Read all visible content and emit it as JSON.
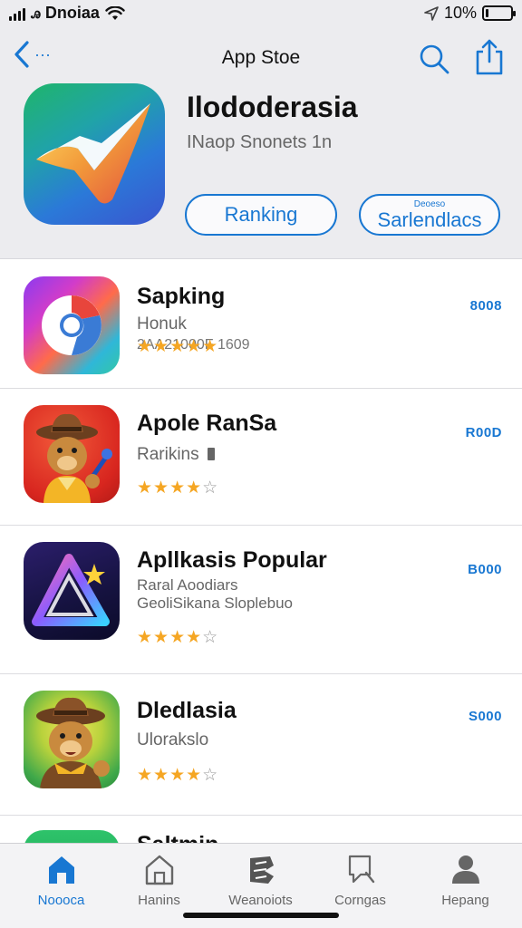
{
  "status_bar": {
    "carrier": "ꭿ Dnoiaa",
    "battery_text": "10%",
    "battery_level": 0.1
  },
  "header": {
    "back_label": "···",
    "title": "App Stoe",
    "app_title": "Ilododerasia",
    "app_subtitle": "INaop Snonets  1n",
    "ranking_button": "Ranking",
    "second_button_tiny": "Deoeso",
    "second_button": "Sarlendlacs"
  },
  "apps": [
    {
      "name": "Sapking",
      "subtitle": "Honuk",
      "stars_filled": 5,
      "stars_total": 5,
      "rating_meta": "2AA21000F 1609",
      "action": "8008",
      "icon": "chrome-like-icon"
    },
    {
      "name": "Apole RanSa",
      "subtitle": "Rarikins",
      "stars_filled": 4,
      "stars_total": 5,
      "action": "R00D",
      "icon": "cowboy-bear-icon"
    },
    {
      "name": "Apllkasis Popular",
      "subtitle": "Raral Aoodiars",
      "subtitle2": "GeoliSikana Sloplebuo",
      "stars_filled": 4,
      "stars_total": 5,
      "action": "B000",
      "icon": "triangle-prism-icon"
    },
    {
      "name": "Dledlasia",
      "subtitle": "Ulorakslo",
      "stars_filled": 4,
      "stars_total": 5,
      "action": "S000",
      "icon": "cowboy-bear-icon"
    },
    {
      "name": "Saltmin",
      "icon": "green-app-icon"
    }
  ],
  "tabs": [
    {
      "label": "Noooca",
      "icon": "home-icon",
      "active": true
    },
    {
      "label": "Hanins",
      "icon": "house-outline-icon",
      "active": false
    },
    {
      "label": "Weanoiots",
      "icon": "games-icon",
      "active": false
    },
    {
      "label": "Corngas",
      "icon": "search-icon",
      "active": false
    },
    {
      "label": "Hepang",
      "icon": "person-icon",
      "active": false
    }
  ],
  "colors": {
    "accent": "#1877d2",
    "star": "#f5a623",
    "header_bg": "#ececef"
  }
}
